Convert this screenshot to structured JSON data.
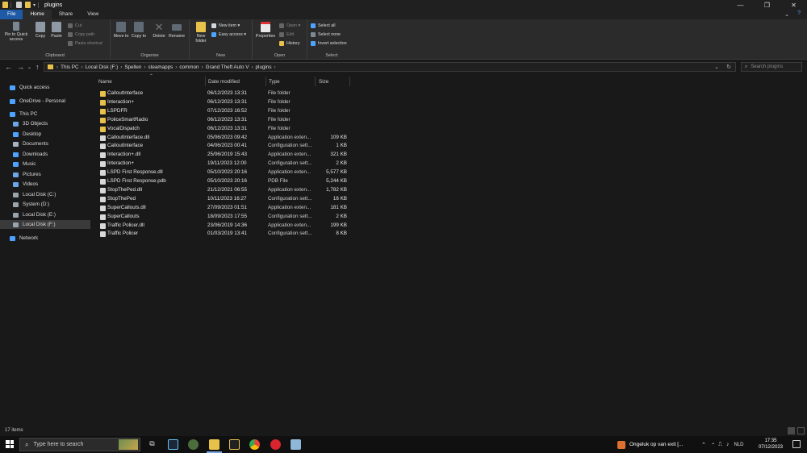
{
  "titlebar": {
    "title": "plugins",
    "controls": [
      "—",
      "❐",
      "✕"
    ]
  },
  "ribbon_tabs": [
    "File",
    "Home",
    "Share",
    "View"
  ],
  "ribbon": {
    "clipboard": {
      "pin": "Pin to Quick access",
      "copy": "Copy",
      "paste": "Paste",
      "cut": "Cut",
      "copy_path": "Copy path",
      "paste_shortcut": "Paste shortcut",
      "label": "Clipboard"
    },
    "organise": {
      "move_to": "Move to",
      "copy_to": "Copy to",
      "delete": "Delete",
      "rename": "Rename",
      "label": "Organise"
    },
    "new": {
      "new_folder": "New folder",
      "new_item": "New item",
      "easy_access": "Easy access",
      "label": "New"
    },
    "open": {
      "properties": "Properties",
      "open": "Open",
      "edit": "Edit",
      "history": "History",
      "label": "Open"
    },
    "select": {
      "select_all": "Select all",
      "select_none": "Select none",
      "invert_selection": "Invert selection",
      "label": "Select"
    }
  },
  "address": {
    "crumbs": [
      "This PC",
      "Local Disk (F:)",
      "Spellen",
      "steamapps",
      "common",
      "Grand Theft Auto V",
      "plugins"
    ],
    "search_placeholder": "Search plugins"
  },
  "sidebar": [
    {
      "label": "Quick access",
      "icon": "star-icon",
      "color": "#4da3ff"
    },
    {
      "label": "OneDrive - Personal",
      "icon": "cloud-icon",
      "color": "#4da3ff"
    },
    {
      "label": "This PC",
      "icon": "computer-icon",
      "color": "#4da3ff"
    },
    {
      "label": "3D Objects",
      "icon": "cube-icon",
      "color": "#6aa6e8"
    },
    {
      "label": "Desktop",
      "icon": "desktop-icon",
      "color": "#4da3ff"
    },
    {
      "label": "Documents",
      "icon": "documents-icon",
      "color": "#aab4c0"
    },
    {
      "label": "Downloads",
      "icon": "download-icon",
      "color": "#4da3ff"
    },
    {
      "label": "Music",
      "icon": "music-icon",
      "color": "#4da3ff"
    },
    {
      "label": "Pictures",
      "icon": "pictures-icon",
      "color": "#6aa6e8"
    },
    {
      "label": "Videos",
      "icon": "videos-icon",
      "color": "#6aa6e8"
    },
    {
      "label": "Local Disk (C:)",
      "icon": "drive-icon",
      "color": "#9aa4ad"
    },
    {
      "label": "System (D:)",
      "icon": "drive-icon",
      "color": "#9aa4ad"
    },
    {
      "label": "Local Disk (E:)",
      "icon": "drive-icon",
      "color": "#9aa4ad"
    },
    {
      "label": "Local Disk (F:)",
      "icon": "drive-icon",
      "color": "#9aa4ad"
    },
    {
      "label": "Network",
      "icon": "network-icon",
      "color": "#4da3ff"
    }
  ],
  "columns": {
    "name": "Name",
    "date": "Date modified",
    "type": "Type",
    "size": "Size"
  },
  "files": [
    {
      "name": "CalloutInterface",
      "date": "06/12/2023 13:31",
      "type": "File folder",
      "size": "",
      "kind": "folder"
    },
    {
      "name": "Interaction+",
      "date": "06/12/2023 13:31",
      "type": "File folder",
      "size": "",
      "kind": "folder"
    },
    {
      "name": "LSPDFR",
      "date": "07/12/2023 16:52",
      "type": "File folder",
      "size": "",
      "kind": "folder"
    },
    {
      "name": "PoliceSmartRadio",
      "date": "06/12/2023 13:31",
      "type": "File folder",
      "size": "",
      "kind": "folder"
    },
    {
      "name": "VocalDispatch",
      "date": "06/12/2023 13:31",
      "type": "File folder",
      "size": "",
      "kind": "folder"
    },
    {
      "name": "CalloutInterface.dll",
      "date": "05/06/2023 09:42",
      "type": "Application exten...",
      "size": "109 KB",
      "kind": "file"
    },
    {
      "name": "CalloutInterface",
      "date": "04/06/2023 00:41",
      "type": "Configuration sett...",
      "size": "1 KB",
      "kind": "file"
    },
    {
      "name": "Interaction+.dll",
      "date": "25/06/2019 15:43",
      "type": "Application exten...",
      "size": "321 KB",
      "kind": "file"
    },
    {
      "name": "Interaction+",
      "date": "19/11/2023 12:00",
      "type": "Configuration sett...",
      "size": "2 KB",
      "kind": "file"
    },
    {
      "name": "LSPD First Response.dll",
      "date": "05/10/2023 20:16",
      "type": "Application exten...",
      "size": "5,577 KB",
      "kind": "file"
    },
    {
      "name": "LSPD First Response.pdb",
      "date": "05/10/2023 20:16",
      "type": "PDB File",
      "size": "5,244 KB",
      "kind": "file"
    },
    {
      "name": "StopThePed.dll",
      "date": "21/12/2021 06:55",
      "type": "Application exten...",
      "size": "1,782 KB",
      "kind": "file"
    },
    {
      "name": "StopThePed",
      "date": "10/11/2023 16:27",
      "type": "Configuration sett...",
      "size": "16 KB",
      "kind": "file"
    },
    {
      "name": "SuperCallouts.dll",
      "date": "27/09/2023 01:51",
      "type": "Application exten...",
      "size": "181 KB",
      "kind": "file"
    },
    {
      "name": "SuperCallouts",
      "date": "18/09/2023 17:55",
      "type": "Configuration sett...",
      "size": "2 KB",
      "kind": "file"
    },
    {
      "name": "Traffic Policer.dll",
      "date": "23/06/2019 14:36",
      "type": "Application exten...",
      "size": "199 KB",
      "kind": "file"
    },
    {
      "name": "Traffic Policer",
      "date": "01/03/2019 13:41",
      "type": "Configuration sett...",
      "size": "8 KB",
      "kind": "file"
    }
  ],
  "status": {
    "count": "17 items"
  },
  "taskbar": {
    "search_placeholder": "Type here to search",
    "notification": "Ongeluk op van exit [...",
    "language": "NLD",
    "time": "17:35",
    "date": "07/12/2023"
  }
}
